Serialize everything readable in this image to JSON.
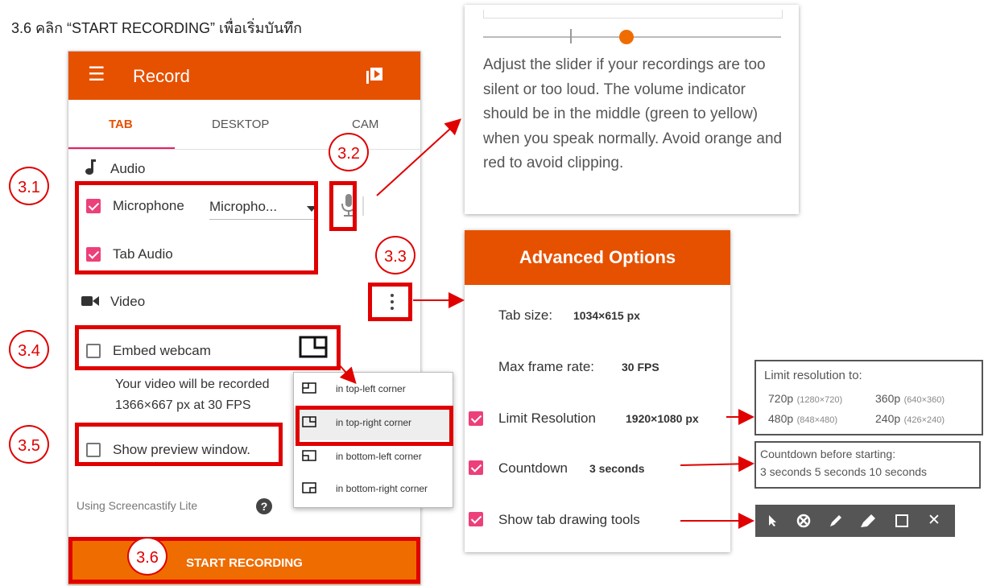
{
  "caption": "3.6 คลิก “START RECORDING” เพื่อเริ่มบันทึก",
  "popup": {
    "title": "Record",
    "menu_icon": "hamburger-menu-icon",
    "tabs": [
      "TAB",
      "DESKTOP",
      "CAM"
    ],
    "audio": {
      "section_label": "Audio",
      "microphone_label": "Microphone",
      "microphone_select": "Micropho...",
      "tab_audio_label": "Tab Audio"
    },
    "video": {
      "section_label": "Video",
      "embed_webcam_label": "Embed webcam",
      "record_info_line1": "Your video will be recorded",
      "record_info_line2": "1366×667 px at 30 FPS",
      "show_preview_label": "Show preview window."
    },
    "lite_label": "Using Screencastify Lite",
    "help_glyph": "?",
    "start_button": "START RECORDING"
  },
  "corner_menu": [
    {
      "label": "in top-left corner",
      "selected": false
    },
    {
      "label": "in top-right corner",
      "selected": true
    },
    {
      "label": "in bottom-left corner",
      "selected": false
    },
    {
      "label": "in bottom-right corner",
      "selected": false
    }
  ],
  "mic_panel": {
    "text": "Adjust the slider if your recordings are too silent or too loud. The volume indicator should be in the middle (green to yellow) when you speak normally. Avoid orange and red to avoid clipping.",
    "slider_value": 0.48
  },
  "advanced": {
    "title": "Advanced Options",
    "tab_size_label": "Tab size:",
    "tab_size_value": "1034×615 px",
    "max_fps_label": "Max frame rate:",
    "max_fps_value": "30 FPS",
    "limit_res_label": "Limit Resolution",
    "limit_res_value": "1920×1080 px",
    "countdown_label": "Countdown",
    "countdown_value": "3 seconds",
    "drawing_tools_label": "Show tab drawing tools"
  },
  "resolution_box": {
    "title": "Limit resolution to:",
    "options": [
      {
        "name": "720p",
        "dims": "(1280×720)"
      },
      {
        "name": "360p",
        "dims": "(640×360)"
      },
      {
        "name": "480p",
        "dims": "(848×480)"
      },
      {
        "name": "240p",
        "dims": "(426×240)"
      }
    ]
  },
  "countdown_box": {
    "title": "Countdown before starting:",
    "options": "3 seconds 5 seconds 10 seconds"
  },
  "tools": [
    "pointer-icon",
    "eraser-icon",
    "pen-icon",
    "highlighter-icon",
    "rectangle-icon",
    "close-icon"
  ],
  "tools_glyphs": {
    "close": "✕"
  },
  "annotations": [
    "3.1",
    "3.2",
    "3.3",
    "3.4",
    "3.5",
    "3.6"
  ],
  "colors": {
    "brand_orange": "#e65100",
    "button_orange": "#ef6c00",
    "checkbox_pink": "#ec407a",
    "annotation_red": "#e00000"
  }
}
